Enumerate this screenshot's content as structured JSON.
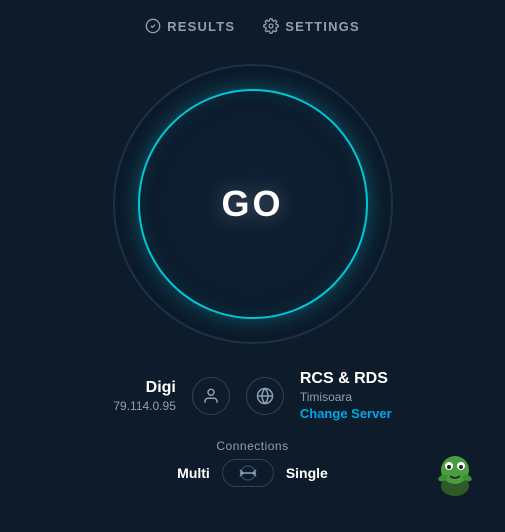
{
  "nav": {
    "results_label": "RESULTS",
    "settings_label": "SETTINGS"
  },
  "speedometer": {
    "go_label": "GO"
  },
  "isp": {
    "name": "Digi",
    "ip": "79.114.0.95"
  },
  "server": {
    "name": "RCS & RDS",
    "location": "Timisoara",
    "change_label": "Change Server"
  },
  "connections": {
    "label": "Connections",
    "multi_label": "Multi",
    "single_label": "Single"
  },
  "colors": {
    "accent": "#00c8d7",
    "link": "#00a8e8",
    "bg": "#0d1b2a",
    "text_muted": "#8ca0b3"
  }
}
